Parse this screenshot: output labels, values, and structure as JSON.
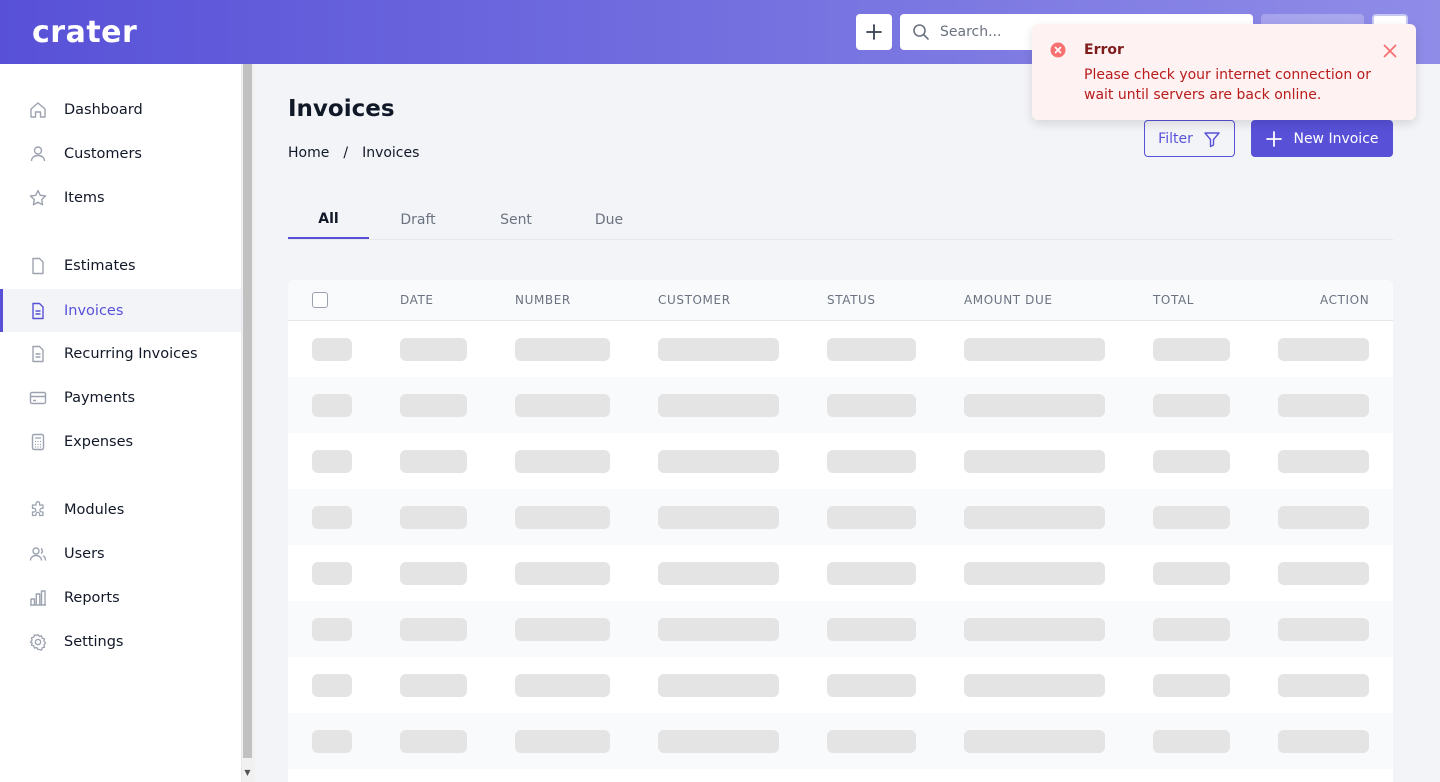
{
  "brand": {
    "logo_text": "crater",
    "accent": "#5851d8"
  },
  "header": {
    "search_placeholder": "Search..."
  },
  "sidebar": {
    "items": [
      {
        "label": "Dashboard",
        "icon": "home-icon"
      },
      {
        "label": "Customers",
        "icon": "user-icon"
      },
      {
        "label": "Items",
        "icon": "star-icon"
      },
      {
        "label": "Estimates",
        "icon": "document-icon"
      },
      {
        "label": "Invoices",
        "icon": "document-text-icon",
        "active": true
      },
      {
        "label": "Recurring Invoices",
        "icon": "document-text-icon"
      },
      {
        "label": "Payments",
        "icon": "credit-card-icon"
      },
      {
        "label": "Expenses",
        "icon": "calculator-icon"
      },
      {
        "label": "Modules",
        "icon": "puzzle-icon"
      },
      {
        "label": "Users",
        "icon": "users-icon"
      },
      {
        "label": "Reports",
        "icon": "chart-bar-icon"
      },
      {
        "label": "Settings",
        "icon": "cog-icon"
      }
    ]
  },
  "page": {
    "title": "Invoices",
    "breadcrumb": {
      "home": "Home",
      "separator": "/",
      "current": "Invoices"
    },
    "filter_label": "Filter",
    "new_label": "New Invoice"
  },
  "tabs": [
    {
      "label": "All",
      "active": true
    },
    {
      "label": "Draft"
    },
    {
      "label": "Sent"
    },
    {
      "label": "Due"
    }
  ],
  "table": {
    "columns": [
      "DATE",
      "NUMBER",
      "CUSTOMER",
      "STATUS",
      "AMOUNT DUE",
      "TOTAL",
      "ACTION"
    ],
    "loading_rows": 8
  },
  "toast": {
    "title": "Error",
    "message": "Please check your internet connection or wait until servers are back online.",
    "color": "#b91c1c"
  }
}
